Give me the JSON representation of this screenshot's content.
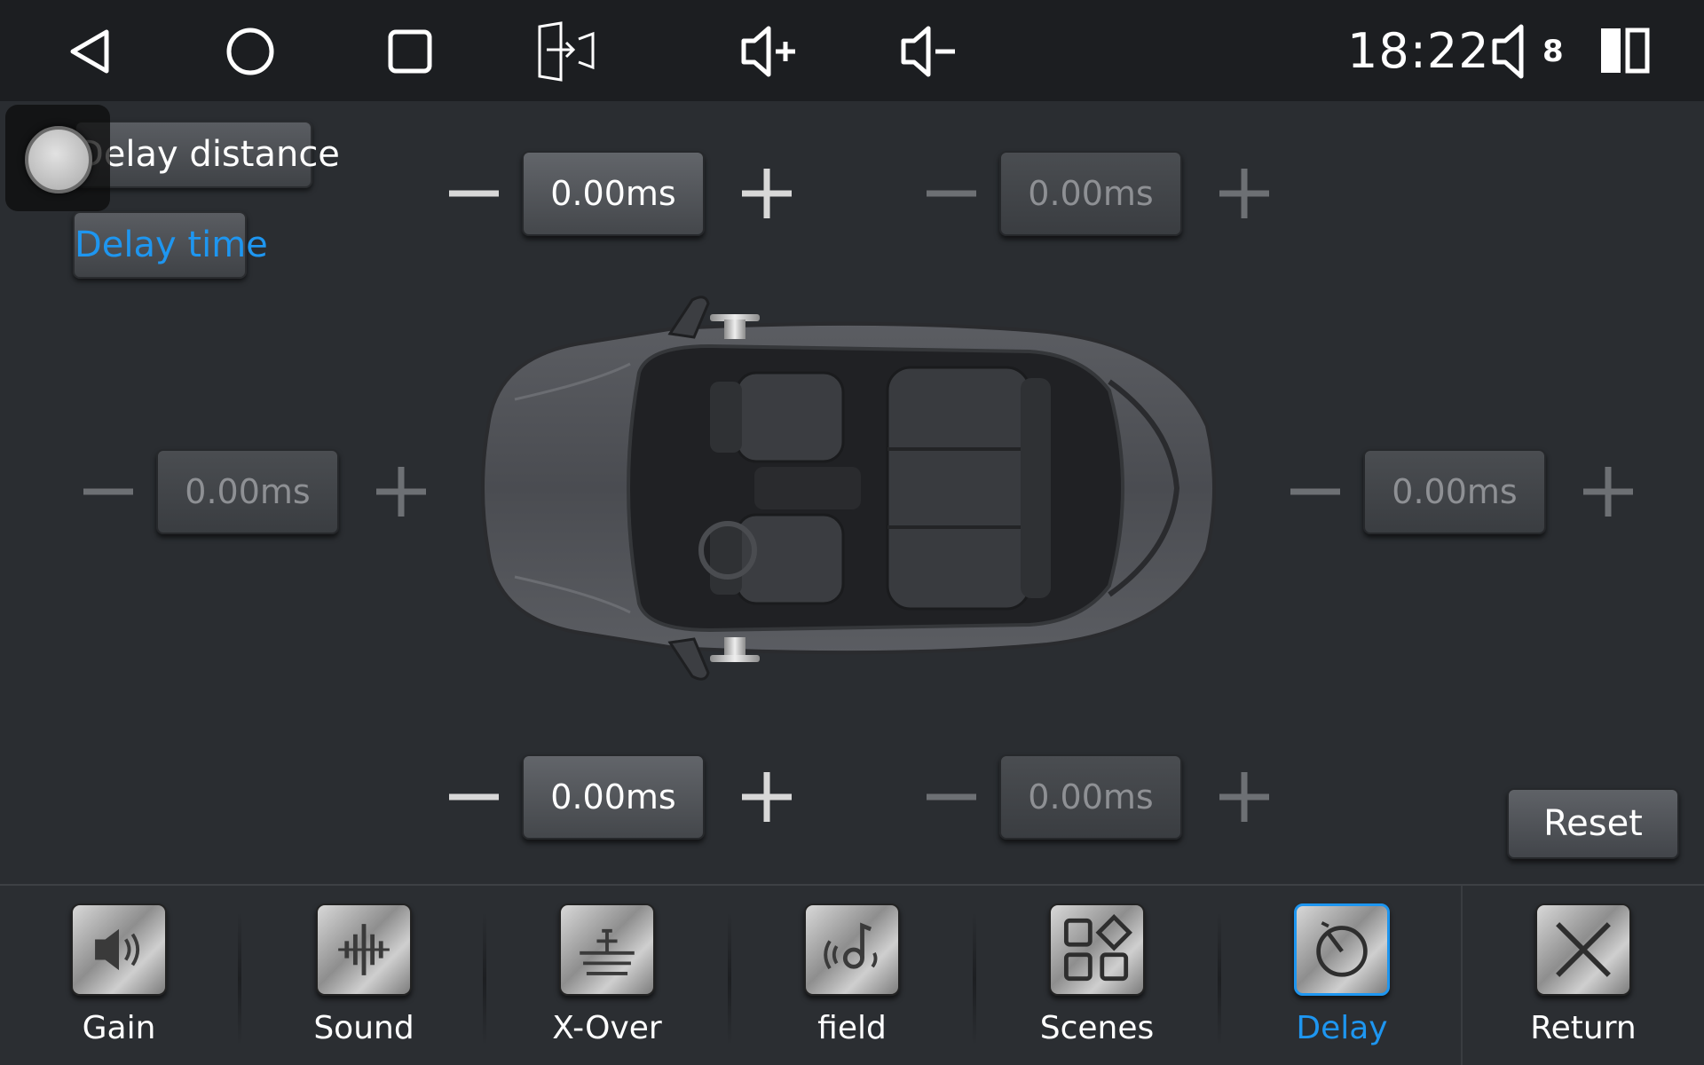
{
  "status_bar": {
    "time": "18:22",
    "volume_level": "8",
    "buttons": [
      "back",
      "home",
      "recents",
      "screen-switch",
      "volume-up",
      "volume-down"
    ]
  },
  "mode": {
    "distance_label": "Delay distance",
    "time_label": "Delay time",
    "selected": "Delay time"
  },
  "delays": {
    "front_left": "0.00ms",
    "front_right": "0.00ms",
    "middle_left": "0.00ms",
    "middle_right": "0.00ms",
    "rear_left": "0.00ms",
    "rear_right": "0.00ms"
  },
  "reset_label": "Reset",
  "nav": {
    "items": [
      {
        "label": "Gain",
        "icon": "speaker-icon"
      },
      {
        "label": "Sound",
        "icon": "sound-wave-icon"
      },
      {
        "label": "X-Over",
        "icon": "xover-icon"
      },
      {
        "label": "field",
        "icon": "sound-field-icon"
      },
      {
        "label": "Scenes",
        "icon": "scenes-icon"
      },
      {
        "label": "Delay",
        "icon": "delay-timer-icon"
      },
      {
        "label": "Return",
        "icon": "close-icon"
      }
    ],
    "active": "Delay"
  },
  "colors": {
    "accent": "#1e96f0",
    "background": "#2a2d31",
    "status_bar": "#1c1e21"
  }
}
